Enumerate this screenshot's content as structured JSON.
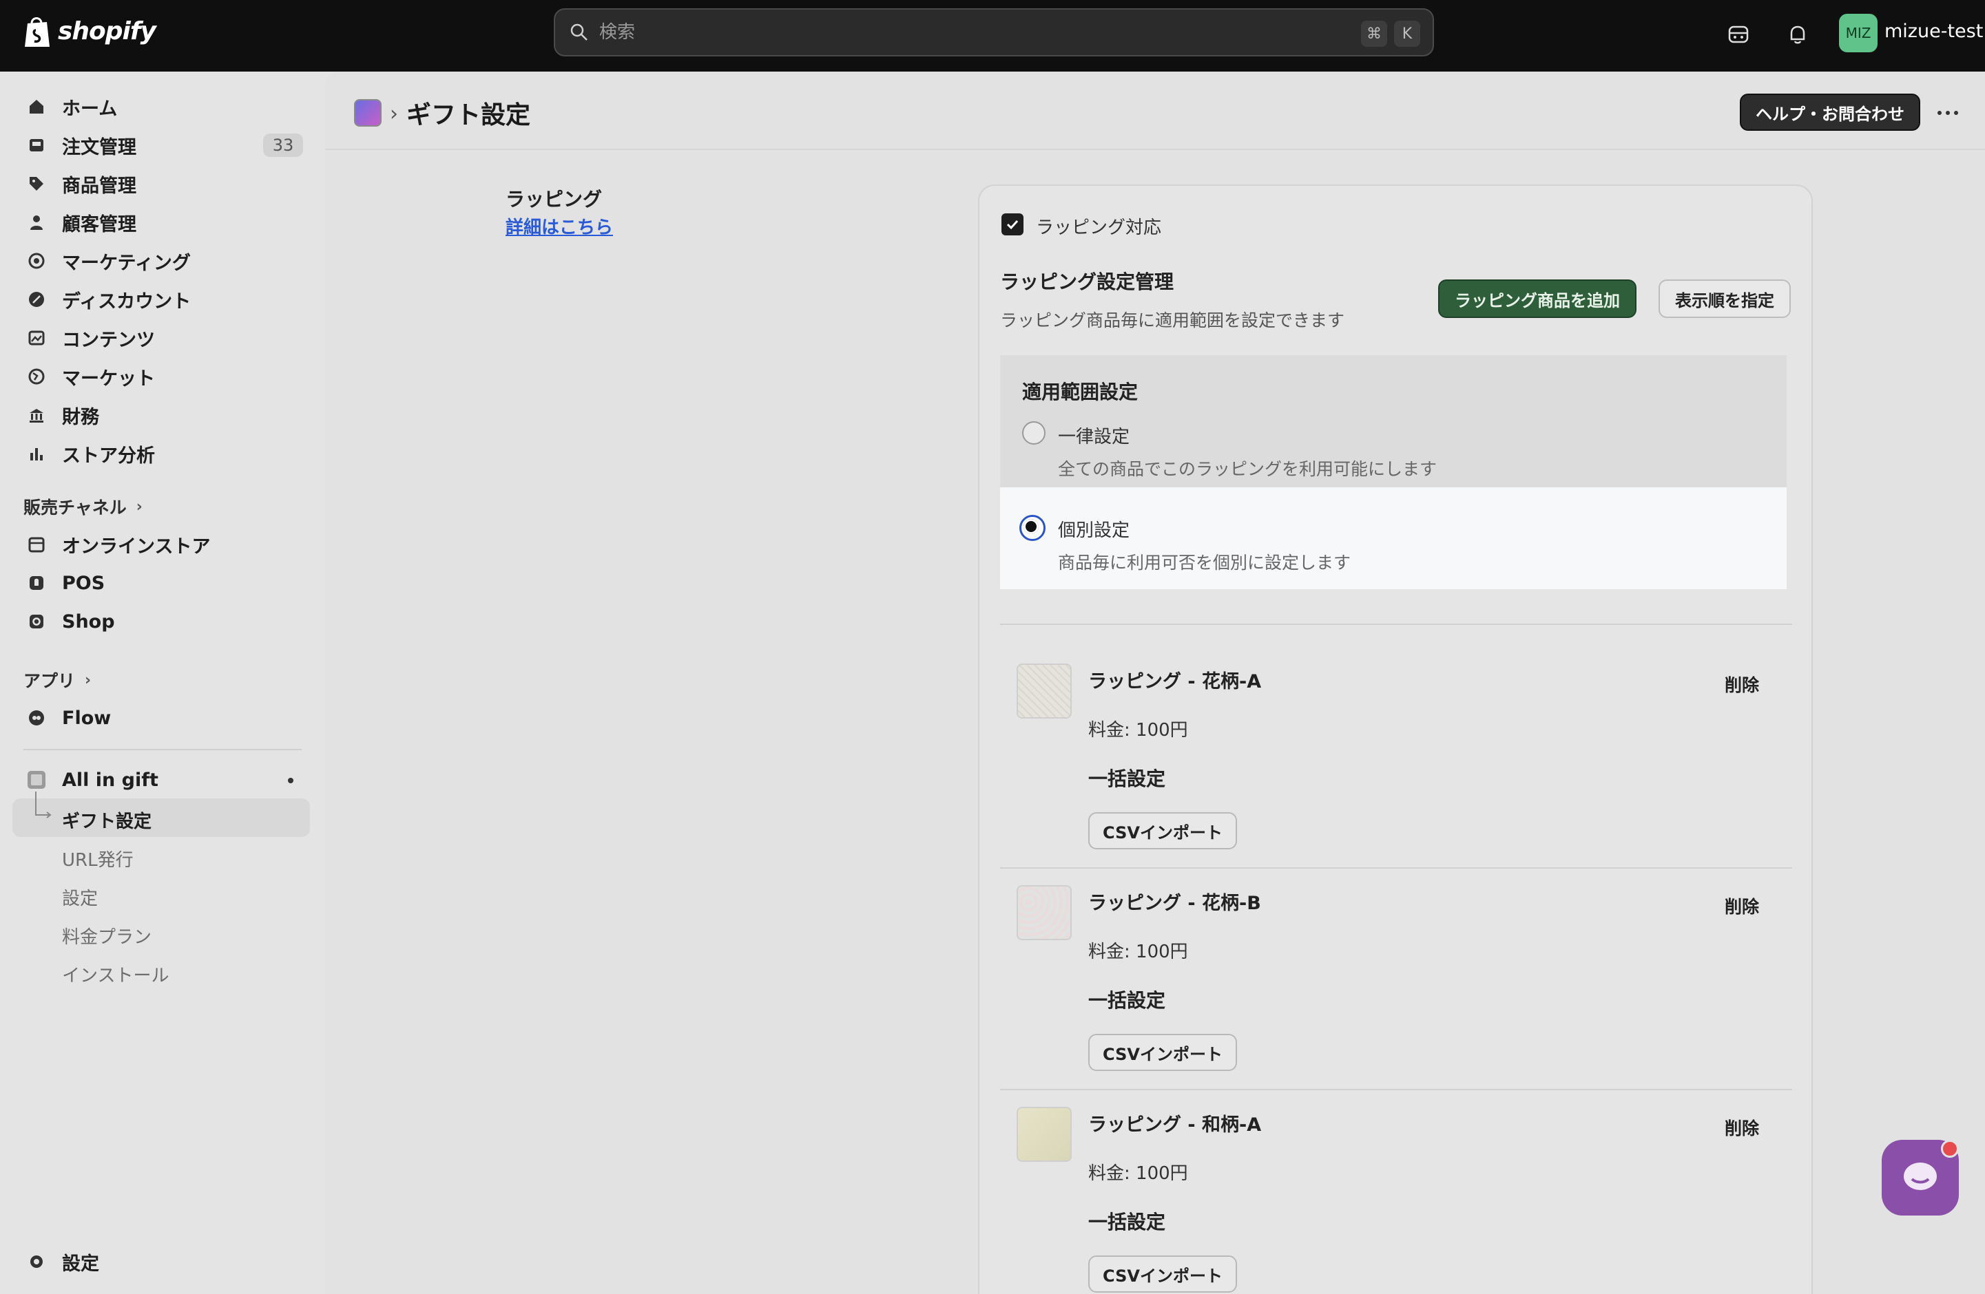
{
  "topbar": {
    "brand": "shopify",
    "search_placeholder": "検索",
    "kbd_cmd": "⌘",
    "kbd_k": "K",
    "avatar_initials": "MIZ",
    "account_name": "mizue-test"
  },
  "sidebar": {
    "items": [
      {
        "label": "ホーム"
      },
      {
        "label": "注文管理",
        "badge": "33"
      },
      {
        "label": "商品管理"
      },
      {
        "label": "顧客管理"
      },
      {
        "label": "マーケティング"
      },
      {
        "label": "ディスカウント"
      },
      {
        "label": "コンテンツ"
      },
      {
        "label": "マーケット"
      },
      {
        "label": "財務"
      },
      {
        "label": "ストア分析"
      }
    ],
    "sales_channels_heading": "販売チャネル",
    "channels": [
      {
        "label": "オンラインストア"
      },
      {
        "label": "POS"
      },
      {
        "label": "Shop"
      }
    ],
    "apps_heading": "アプリ",
    "apps": [
      {
        "label": "Flow"
      },
      {
        "label": "All in gift"
      }
    ],
    "app_subitems": [
      "ギフト設定",
      "URL発行",
      "設定",
      "料金プラン",
      "インストール"
    ],
    "settings_label": "設定"
  },
  "page": {
    "title": "ギフト設定",
    "help_button": "ヘルプ・お問合わせ",
    "section_title": "ラッピング",
    "section_link": "詳細はこちら",
    "wrapping_checkbox_label": "ラッピング対応",
    "wrapping_checked": true,
    "mgmt_title": "ラッピング設定管理",
    "mgmt_desc": "ラッピング商品毎に適用範囲を設定できます",
    "add_button": "ラッピング商品を追加",
    "order_button": "表示順を指定",
    "scope_title": "適用範囲設定",
    "scope_options": [
      {
        "label": "一律設定",
        "desc": "全ての商品でこのラッピングを利用可能にします",
        "selected": false
      },
      {
        "label": "個別設定",
        "desc": "商品毎に利用可否を個別に設定します",
        "selected": true
      }
    ],
    "wrapping_items": [
      {
        "name": "ラッピング - 花柄-A",
        "price": "料金: 100円",
        "bulk": "一括設定",
        "csv": "CSVインポート",
        "delete": "削除"
      },
      {
        "name": "ラッピング - 花柄-B",
        "price": "料金: 100円",
        "bulk": "一括設定",
        "csv": "CSVインポート",
        "delete": "削除"
      },
      {
        "name": "ラッピング - 和柄-A",
        "price": "料金: 100円",
        "bulk": "一括設定",
        "csv": "CSVインポート",
        "delete": "削除"
      }
    ]
  },
  "colors": {
    "topbar": "#0f0f0f",
    "primary_button": "#2f5f3a",
    "link": "#2a5bd7",
    "avatar": "#5fc38a",
    "chat": "#8a4fa8"
  }
}
